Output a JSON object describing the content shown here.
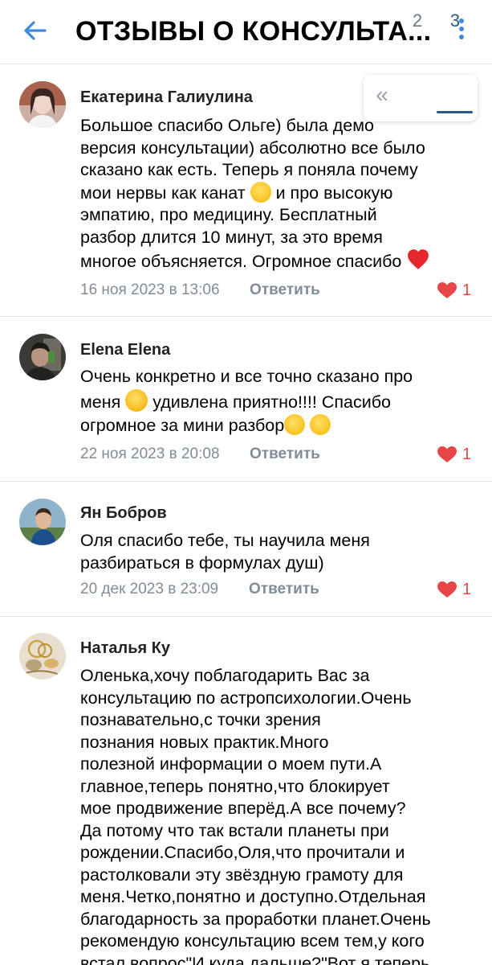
{
  "header": {
    "title": "ОТЗЫВЫ О КОНСУЛЬТА...",
    "back_icon": "arrow-left-icon",
    "menu_icon": "more-vertical-icon",
    "accent": "#3f8ae0"
  },
  "pager": {
    "first_glyph": "«",
    "pages": [
      "2",
      "3"
    ],
    "current": "3"
  },
  "comments": [
    {
      "author": "Екатерина Галиулина",
      "text_1": "Большое спасибо Ольге) была демо\nверсия консультации) абсолютно все было\nсказано как есть. Теперь я поняла почему\nмои нервы как канат ",
      "text_2": " и про высокую\nэмпатию, про медицину.  Бесплатный\nразбор длится 10 минут, за это время\nмногое объясняется. Огромное спасибо ",
      "date": "16 ноя 2023 в 13:06",
      "reply": "Ответить",
      "likes": "1"
    },
    {
      "author": "Elena Elena",
      "text_1": "Очень конкретно и все точно сказано про\nменя ",
      "text_2": " удивлена приятно!!!! Спасибо\nогромное за мини разбор",
      "date": "22 ноя 2023 в 20:08",
      "reply": "Ответить",
      "likes": "1"
    },
    {
      "author": "Ян Бобров",
      "text": "Оля спасибо тебе,  ты научила меня\nразбираться  в формулах душ)",
      "date": "20 дек 2023 в 23:09",
      "reply": "Ответить",
      "likes": "1"
    },
    {
      "author": "Наталья Ку",
      "text": "Оленька,хочу поблагодарить Вас за\nконсультацию по астропсихологии.Очень\nпознавательно,с точки зрения\nпознания новых практик.Много\nполезной информации о моем пути.А\nглавное,теперь понятно,что блокирует\nмое продвижение вперёд.А все почему?\nДа потому что так встали планеты при\nрождении.Спасибо,Оля,что прочитали и\nрастолковали эту звёздную грамоту для\nменя.Четко,понятно и доступно.Отдельная\nблагодарность за проработки планет.Очень\nрекомендую консультацию всем тем,у кого\nвстал вопрос\"И куда дальше?\"Вот я теперь"
    }
  ],
  "colors": {
    "link": "#2a5885",
    "secondary": "#818c99",
    "like": "#e64646",
    "divider": "#e3e4e8"
  }
}
